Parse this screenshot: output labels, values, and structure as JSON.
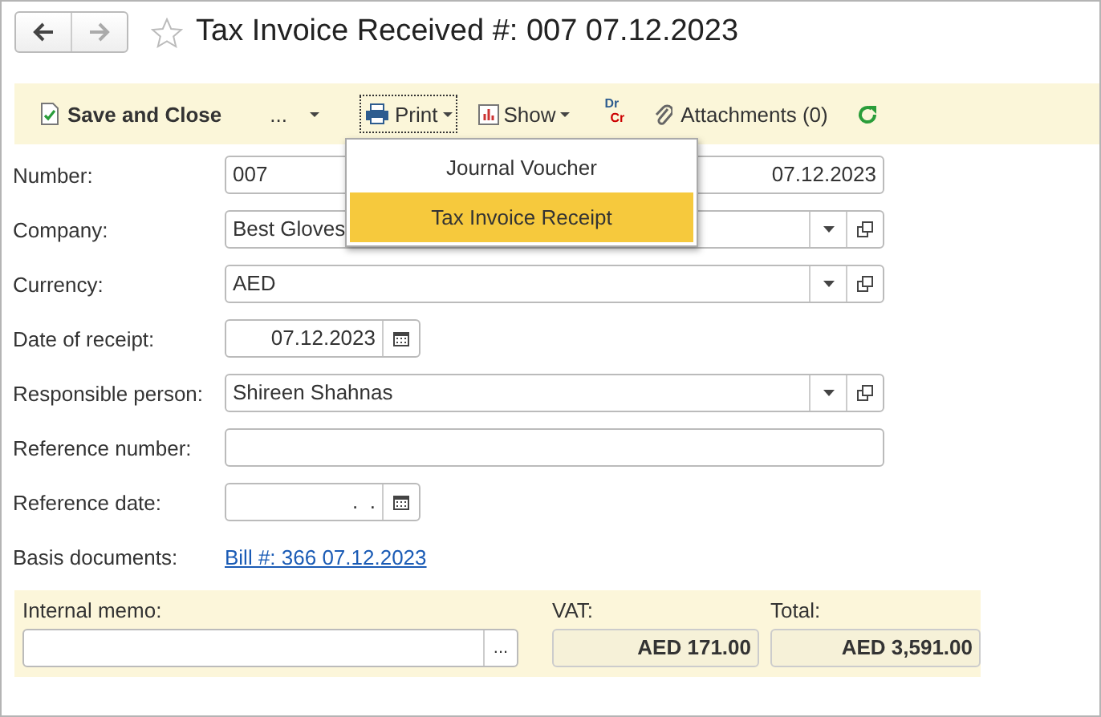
{
  "window": {
    "title": "Tax Invoice Received #: 007 07.12.2023",
    "back_disabled": false,
    "forward_disabled": true,
    "favorite": false
  },
  "toolbar": [
    {
      "kind": "save",
      "label": "Save and Close"
    },
    {
      "kind": "more",
      "label": "..."
    },
    {
      "kind": "print",
      "label": "Print",
      "expanded": true
    },
    {
      "kind": "show",
      "label": "Show"
    },
    {
      "kind": "drcr",
      "label": "Dr",
      "label2": "Cr"
    },
    {
      "kind": "attach",
      "label": "Attachments (0)"
    },
    {
      "kind": "refresh"
    }
  ],
  "print_menu": [
    {
      "label": "Journal Voucher",
      "selected": false
    },
    {
      "label": "Tax Invoice Receipt",
      "selected": true
    }
  ],
  "fields": [
    {
      "kind": "number",
      "label": "Number:",
      "value": "007",
      "date": "07.12.2023"
    },
    {
      "kind": "select",
      "label": "Company:",
      "value": "Best Gloves"
    },
    {
      "kind": "select",
      "label": "Currency:",
      "value": "AED"
    },
    {
      "kind": "date",
      "label": "Date of receipt:",
      "value": "07.12.2023"
    },
    {
      "kind": "select",
      "label": "Responsible person:",
      "value": "Shireen Shahnas"
    },
    {
      "kind": "text",
      "label": "Reference number:"
    },
    {
      "kind": "date",
      "label": "Reference date:",
      "value": " .  ."
    },
    {
      "kind": "link",
      "label": "Basis documents:",
      "value": "Bill #: 366 07.12.2023"
    }
  ],
  "footer": {
    "memo_label": "Internal memo:",
    "memo_button": "...",
    "vat_label": "VAT:",
    "vat": "AED 171.00",
    "total_label": "Total:",
    "total": "AED 3,591.00"
  }
}
